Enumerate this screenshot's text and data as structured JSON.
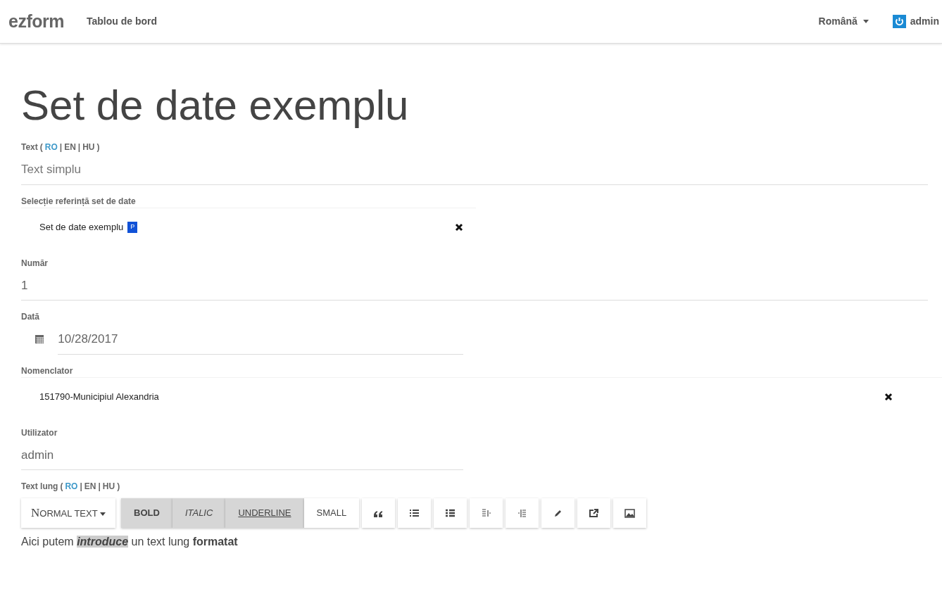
{
  "navbar": {
    "brand": "ezform",
    "links": [
      {
        "label": "Tablou de bord"
      }
    ],
    "language": "Română",
    "user": "admin"
  },
  "title": "Set de date exemplu",
  "fields": [
    {
      "kind": "text",
      "label": "Text",
      "bracket_open": "(",
      "bracket_close": ")",
      "separator": "|",
      "languages": [
        {
          "code": "RO",
          "selected": true
        },
        {
          "code": "EN",
          "selected": false
        },
        {
          "code": "HU",
          "selected": false
        }
      ],
      "placeholder": "Text simplu"
    },
    {
      "kind": "select",
      "label": "Selecție referință set de date",
      "value": "Set de date exemplu",
      "tag": "P"
    },
    {
      "kind": "text",
      "label": "Număr",
      "value": "1"
    },
    {
      "kind": "date",
      "label": "Dată",
      "value": "10/28/2017"
    },
    {
      "kind": "select",
      "label": "Nomenclator",
      "value": "151790-Municipiul Alexandria"
    },
    {
      "kind": "text",
      "label": "Utilizator",
      "value": "admin"
    },
    {
      "kind": "editor",
      "label": "Text lung",
      "bracket_open": "(",
      "bracket_close": ")",
      "separator": "|",
      "languages": [
        {
          "code": "RO",
          "selected": true
        },
        {
          "code": "EN",
          "selected": false
        },
        {
          "code": "HU",
          "selected": false
        }
      ],
      "style_menu": "NORMAL TEXT",
      "format_buttons": [
        {
          "label": "BOLD",
          "kind": "bold",
          "active": true
        },
        {
          "label": "ITALIC",
          "kind": "italic",
          "active": true
        },
        {
          "label": "UNDERLINE",
          "kind": "underline",
          "active": true
        },
        {
          "label": "SMALL",
          "kind": "small",
          "active": false
        }
      ],
      "content": [
        {
          "text": "Aici putem ",
          "bold": false,
          "italic": false,
          "highlighted": false
        },
        {
          "text": "introduce",
          "bold": true,
          "italic": true,
          "highlighted": true
        },
        {
          "text": " un text lung ",
          "bold": false,
          "italic": false,
          "highlighted": false
        },
        {
          "text": "formatat",
          "bold": true,
          "italic": false,
          "highlighted": false
        }
      ]
    }
  ]
}
